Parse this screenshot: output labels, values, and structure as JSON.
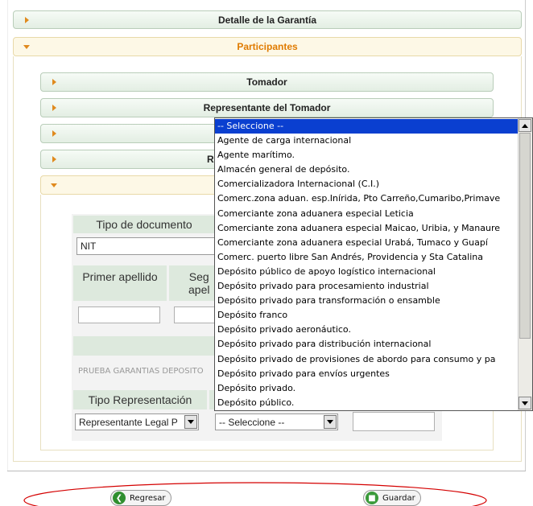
{
  "sections": {
    "detalle": "Detalle de la Garantía",
    "participantes": "Participantes",
    "tomador": "Tomador",
    "representante_tomador": "Representante del Tomador",
    "row3_partial": "",
    "row4_partial": "R"
  },
  "form": {
    "tipo_documento_label": "Tipo de documento",
    "tipo_documento_value": "NIT",
    "primer_apellido_label": "Primer apellido",
    "segundo_apellido_label_partial": "Seg\napel",
    "razon_social_value": "PRUEBA GARANTIAS DEPOSITO",
    "tipo_representacion_label": "Tipo Representación",
    "tipo_representacion_value": "Representante Legal P",
    "second_select_value": "-- Seleccione --"
  },
  "dropdown": {
    "options": [
      "-- Seleccione --",
      "Agente de carga internacional",
      "Agente marítimo.",
      "Almacén general de depósito.",
      "Comercializadora Internacional (C.I.)",
      "Comerc.zona aduan. esp.Inírida, Pto Carreño,Cumaribo,Primave",
      "Comerciante zona aduanera especial Leticia",
      "Comerciante zona aduanera especial Maicao, Uribia, y Manaure",
      "Comerciante zona aduanera especial Urabá, Tumaco y Guapí",
      "Comerc. puerto libre San Andrés, Providencia y Sta Catalina",
      "Depósito público de apoyo logístico internacional",
      "Depósito privado para procesamiento industrial",
      "Depósito privado para transformación o ensamble",
      "Depósito franco",
      "Depósito privado aeronáutico.",
      "Depósito privado para distribución internacional",
      "Depósito privado de provisiones de abordo para consumo y pa",
      "Depósito privado para envíos urgentes",
      "Depósito privado.",
      "Depósito público."
    ],
    "selected_index": 0
  },
  "actions": {
    "back_label": "Regresar",
    "save_label": "Guardar"
  },
  "colors": {
    "section_orange": "#e07b00",
    "dropdown_highlight": "#0a3fd0",
    "annotation_red": "#d40000"
  }
}
